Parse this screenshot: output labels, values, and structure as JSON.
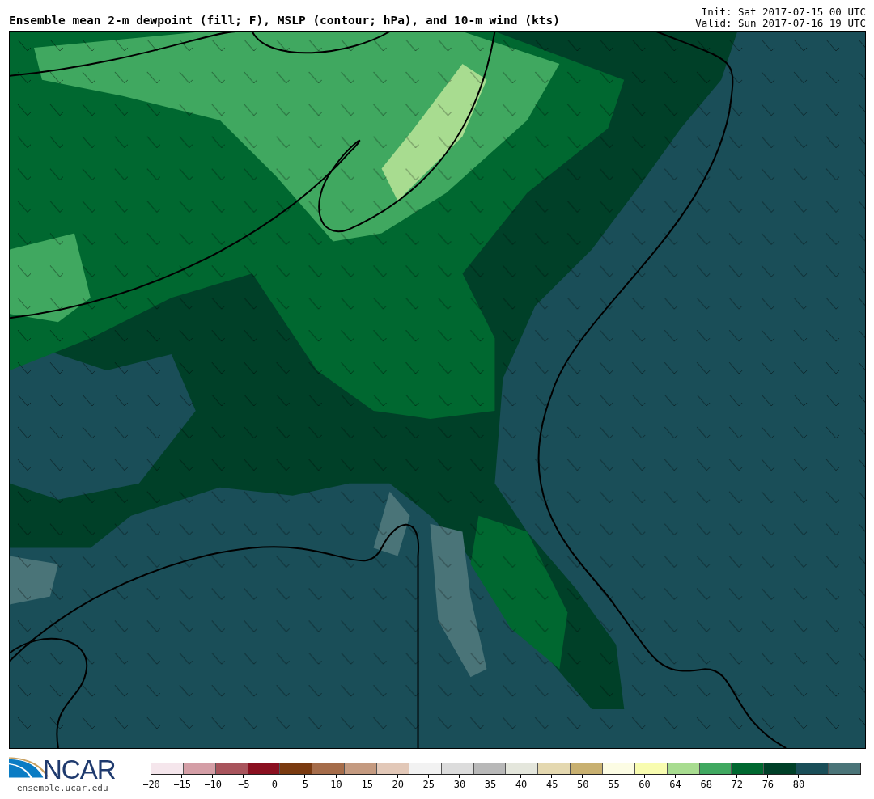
{
  "header": {
    "title": "Ensemble mean 2-m dewpoint (fill; F), MSLP (contour; hPa), and 10-m wind (kts)",
    "init": "Init: Sat 2017-07-15 00 UTC",
    "valid": "Valid: Sun 2017-07-16 19 UTC"
  },
  "logo": {
    "text": "NCAR",
    "url": "ensemble.ucar.edu"
  },
  "colorbar": {
    "bins": [
      {
        "color": "#f5e6ec"
      },
      {
        "color": "#d49ea6"
      },
      {
        "color": "#a8545c"
      },
      {
        "color": "#8a1020"
      },
      {
        "color": "#7a3a10"
      },
      {
        "color": "#a56c4a"
      },
      {
        "color": "#c49a80"
      },
      {
        "color": "#e2c8b8"
      },
      {
        "color": "#f2f2f2"
      },
      {
        "color": "#dcdcdc"
      },
      {
        "color": "#b8b8b8"
      },
      {
        "color": "#e4e6dc"
      },
      {
        "color": "#e4d8b0"
      },
      {
        "color": "#c8b070"
      },
      {
        "color": "#fcfce4"
      },
      {
        "color": "#f8fcb0"
      },
      {
        "color": "#a8dc90"
      },
      {
        "color": "#40a860"
      },
      {
        "color": "#006830"
      },
      {
        "color": "#004028"
      },
      {
        "color": "#1a4e58"
      },
      {
        "color": "#4a7478"
      }
    ],
    "labels": [
      "−20",
      "−15",
      "−10",
      "−5",
      "0",
      "5",
      "10",
      "15",
      "20",
      "25",
      "30",
      "35",
      "40",
      "45",
      "50",
      "55",
      "60",
      "64",
      "68",
      "72",
      "76",
      "80"
    ]
  }
}
